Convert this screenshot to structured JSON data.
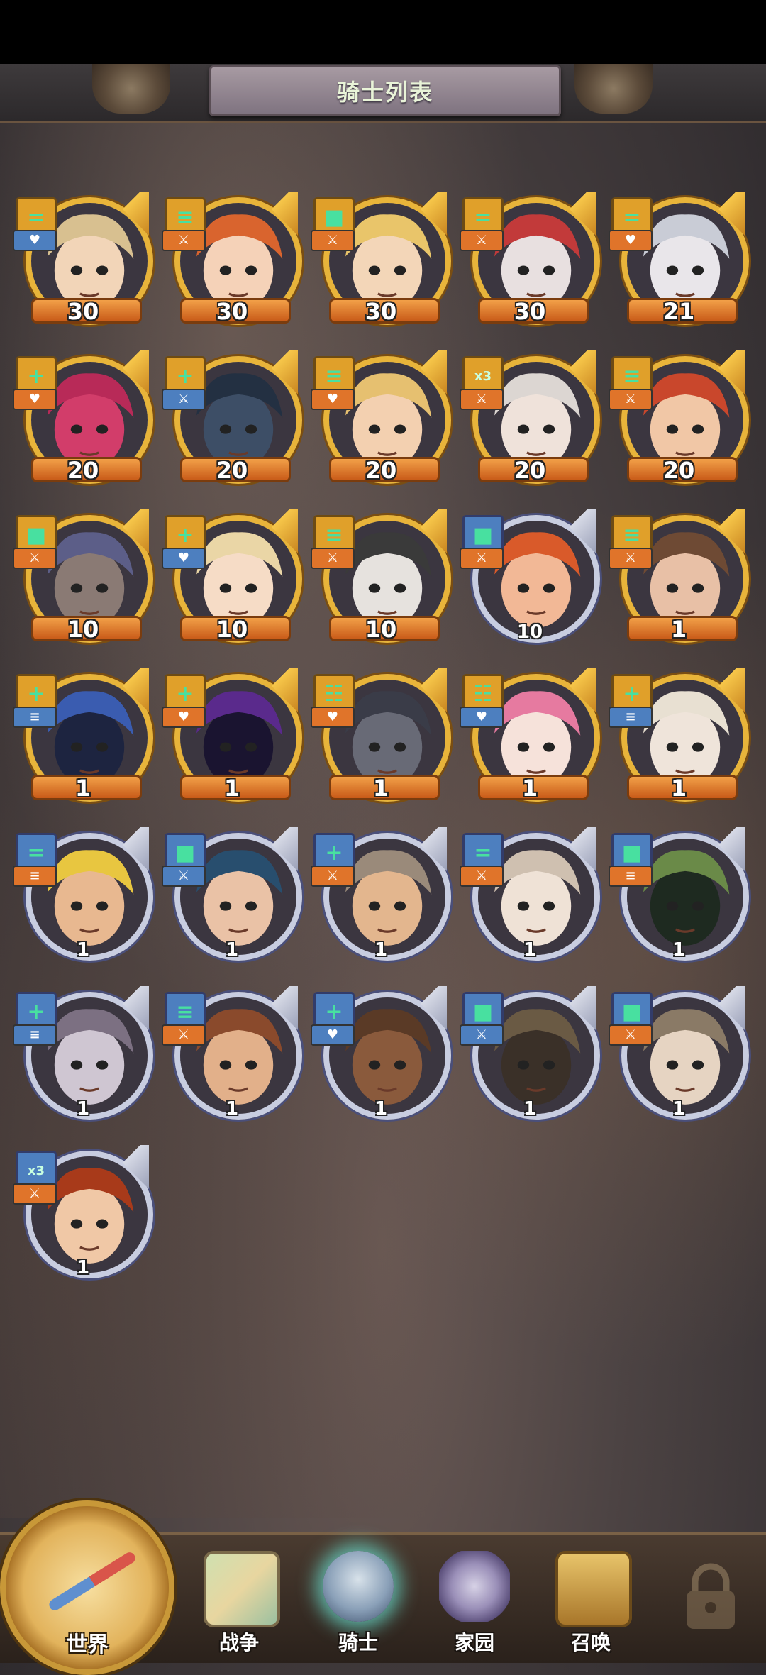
{
  "header": {
    "title": "骑士列表"
  },
  "colors": {
    "gold_frame": "#e8b43a",
    "blue_frame": "#c8cde0",
    "class_teal": "#48e0a0",
    "badge_blue": "#4d7fbf",
    "badge_orange": "#e0742a"
  },
  "knights": [
    {
      "level": "30",
      "rank": "gold",
      "class_icon": "double-bar-icon",
      "class_bg": "#e0a02a",
      "role_icon": "heart-icon",
      "role_bg": "#4d7fbf",
      "skin": "#f2d5b8",
      "hair": "#d8c090"
    },
    {
      "level": "30",
      "rank": "gold",
      "class_icon": "triple-block-icon",
      "class_bg": "#e0a02a",
      "role_icon": "sword-icon",
      "role_bg": "#e0742a",
      "skin": "#f5d2b8",
      "hair": "#d9642e"
    },
    {
      "level": "30",
      "rank": "gold",
      "class_icon": "single-block-icon",
      "class_bg": "#e0a02a",
      "role_icon": "sword-icon",
      "role_bg": "#e0742a",
      "skin": "#f3d6b8",
      "hair": "#e9c56a"
    },
    {
      "level": "30",
      "rank": "gold",
      "class_icon": "double-bar-icon",
      "class_bg": "#e0a02a",
      "role_icon": "sword-icon",
      "role_bg": "#e0742a",
      "skin": "#e8e0e0",
      "hair": "#c23a3a"
    },
    {
      "level": "21",
      "rank": "gold",
      "class_icon": "double-bar-icon",
      "class_bg": "#e0a02a",
      "role_icon": "heart-icon",
      "role_bg": "#e0742a",
      "skin": "#e9e6ea",
      "hair": "#c9ccd6"
    },
    {
      "level": "20",
      "rank": "gold",
      "class_icon": "cross-icon",
      "class_bg": "#e0a02a",
      "role_icon": "heart-icon",
      "role_bg": "#e0742a",
      "skin": "#d23d6a",
      "hair": "#b82a58"
    },
    {
      "level": "20",
      "rank": "gold",
      "class_icon": "cross-icon",
      "class_bg": "#e0a02a",
      "role_icon": "sword-icon",
      "role_bg": "#4d7fbf",
      "skin": "#3d4e66",
      "hair": "#233042"
    },
    {
      "level": "20",
      "rank": "gold",
      "class_icon": "triple-block-icon",
      "class_bg": "#e0a02a",
      "role_icon": "heart-icon",
      "role_bg": "#e0742a",
      "skin": "#f3d0b0",
      "hair": "#e6c070"
    },
    {
      "level": "20",
      "rank": "gold",
      "class_icon": "x3-icon",
      "class_bg": "#e0a02a",
      "role_icon": "sword-icon",
      "role_bg": "#e0742a",
      "skin": "#efe2da",
      "hair": "#dcd6d2"
    },
    {
      "level": "20",
      "rank": "gold",
      "class_icon": "triple-block-icon",
      "class_bg": "#e0a02a",
      "role_icon": "sword-icon",
      "role_bg": "#e0742a",
      "skin": "#f1c7a6",
      "hair": "#c9472c"
    },
    {
      "level": "10",
      "rank": "gold",
      "class_icon": "single-block-icon",
      "class_bg": "#e0a02a",
      "role_icon": "sword-icon",
      "role_bg": "#e0742a",
      "skin": "#8a7a74",
      "hair": "#5c5e88"
    },
    {
      "level": "10",
      "rank": "gold",
      "class_icon": "cross-icon",
      "class_bg": "#e0a02a",
      "role_icon": "heart-icon",
      "role_bg": "#4d7fbf",
      "skin": "#f6dcc6",
      "hair": "#ead6a6"
    },
    {
      "level": "10",
      "rank": "gold",
      "class_icon": "triple-block-icon",
      "class_bg": "#e0a02a",
      "role_icon": "sword-icon",
      "role_bg": "#e0742a",
      "skin": "#e6e2de",
      "hair": "#3a3a3a"
    },
    {
      "level": "10",
      "rank": "blue",
      "class_icon": "single-block-icon",
      "class_bg": "#4d7fbf",
      "role_icon": "sword-icon",
      "role_bg": "#e0742a",
      "skin": "#f2b896",
      "hair": "#d95a2a"
    },
    {
      "level": "1",
      "rank": "gold",
      "class_icon": "triple-block-icon",
      "class_bg": "#e0a02a",
      "role_icon": "sword-icon",
      "role_bg": "#e0742a",
      "skin": "#e8c0a6",
      "hair": "#6e4a34"
    },
    {
      "level": "1",
      "rank": "gold",
      "class_icon": "cross-icon",
      "class_bg": "#e0a02a",
      "role_icon": "shield-icon",
      "role_bg": "#4d7fbf",
      "skin": "#1d2440",
      "hair": "#3a5cb0"
    },
    {
      "level": "1",
      "rank": "gold",
      "class_icon": "cross-icon",
      "class_bg": "#e0a02a",
      "role_icon": "heart-icon",
      "role_bg": "#e0742a",
      "skin": "#1a1430",
      "hair": "#5a2a8c"
    },
    {
      "level": "1",
      "rank": "gold",
      "class_icon": "quad-block-icon",
      "class_bg": "#e0a02a",
      "role_icon": "heart-icon",
      "role_bg": "#e0742a",
      "skin": "#686a76",
      "hair": "#3a3c48"
    },
    {
      "level": "1",
      "rank": "gold",
      "class_icon": "quad-block-icon",
      "class_bg": "#e0a02a",
      "role_icon": "heart-icon",
      "role_bg": "#4d7fbf",
      "skin": "#f6e2da",
      "hair": "#e67aa0"
    },
    {
      "level": "1",
      "rank": "gold",
      "class_icon": "cross-icon",
      "class_bg": "#e0a02a",
      "role_icon": "shield-icon",
      "role_bg": "#4d7fbf",
      "skin": "#efe4da",
      "hair": "#e8e0d2"
    },
    {
      "level": "1",
      "rank": "blue",
      "class_icon": "double-bar-icon",
      "class_bg": "#4d7fbf",
      "role_icon": "shield-icon",
      "role_bg": "#e0742a",
      "skin": "#e8b890",
      "hair": "#e8c640"
    },
    {
      "level": "1",
      "rank": "blue",
      "class_icon": "single-block-icon",
      "class_bg": "#4d7fbf",
      "role_icon": "sword-icon",
      "role_bg": "#4d7fbf",
      "skin": "#eac2a6",
      "hair": "#284e6e"
    },
    {
      "level": "1",
      "rank": "blue",
      "class_icon": "cross-icon",
      "class_bg": "#4d7fbf",
      "role_icon": "sword-icon",
      "role_bg": "#e0742a",
      "skin": "#e3b68e",
      "hair": "#9a8a7a"
    },
    {
      "level": "1",
      "rank": "blue",
      "class_icon": "double-bar-icon",
      "class_bg": "#4d7fbf",
      "role_icon": "sword-icon",
      "role_bg": "#e0742a",
      "skin": "#efe2d6",
      "hair": "#cfc0b0"
    },
    {
      "level": "1",
      "rank": "blue",
      "class_icon": "single-block-icon",
      "class_bg": "#4d7fbf",
      "role_icon": "shield-icon",
      "role_bg": "#e0742a",
      "skin": "#1e2a20",
      "hair": "#6a8a48"
    },
    {
      "level": "1",
      "rank": "blue",
      "class_icon": "cross-icon",
      "class_bg": "#4d7fbf",
      "role_icon": "shield-icon",
      "role_bg": "#4d7fbf",
      "skin": "#cfc6d2",
      "hair": "#7c7082"
    },
    {
      "level": "1",
      "rank": "blue",
      "class_icon": "triple-block-icon",
      "class_bg": "#4d7fbf",
      "role_icon": "sword-icon",
      "role_bg": "#e0742a",
      "skin": "#e2b08a",
      "hair": "#8a4a2c"
    },
    {
      "level": "1",
      "rank": "blue",
      "class_icon": "cross-icon",
      "class_bg": "#4d7fbf",
      "role_icon": "heart-icon",
      "role_bg": "#4d7fbf",
      "skin": "#8a5a3c",
      "hair": "#5a3a26"
    },
    {
      "level": "1",
      "rank": "blue",
      "class_icon": "single-block-icon",
      "class_bg": "#4d7fbf",
      "role_icon": "sword-icon",
      "role_bg": "#4d7fbf",
      "skin": "#3a3028",
      "hair": "#6a5a44"
    },
    {
      "level": "1",
      "rank": "blue",
      "class_icon": "single-block-icon",
      "class_bg": "#4d7fbf",
      "role_icon": "sword-icon",
      "role_bg": "#e0742a",
      "skin": "#e6d4c2",
      "hair": "#8a7a66"
    },
    {
      "level": "1",
      "rank": "blue",
      "class_icon": "x3-icon",
      "class_bg": "#4d7fbf",
      "role_icon": "sword-icon",
      "role_bg": "#e0742a",
      "skin": "#f0c8a6",
      "hair": "#a83a1a"
    }
  ],
  "nav": {
    "world": "世界",
    "war": "战争",
    "knight": "骑士",
    "home": "家园",
    "summon": "召唤"
  }
}
